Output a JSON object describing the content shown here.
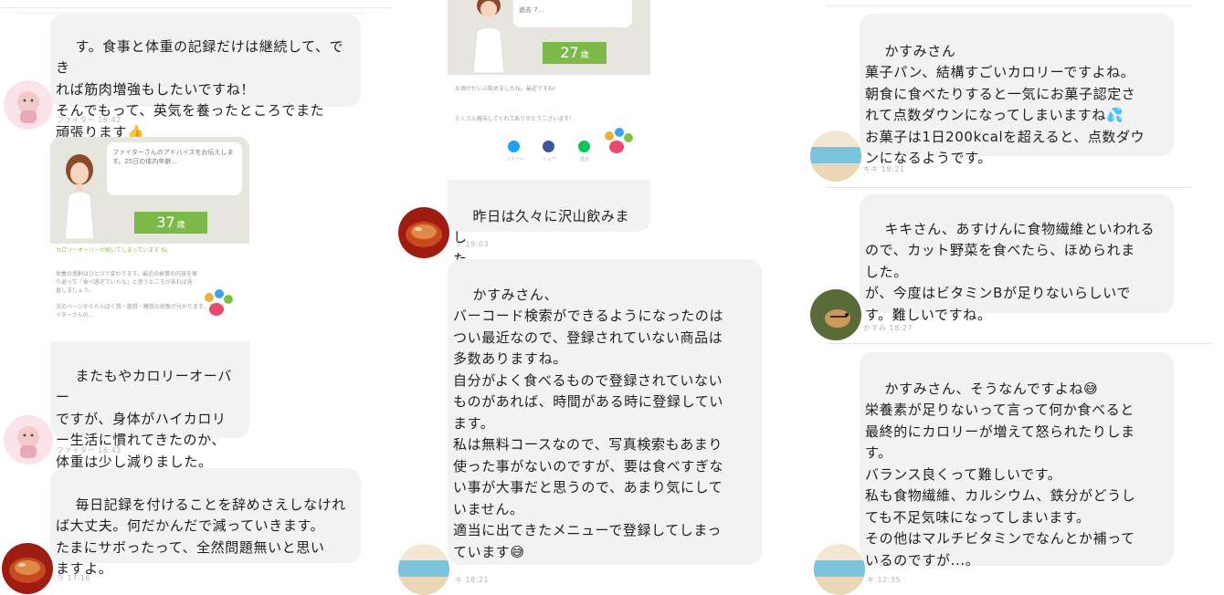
{
  "col1": {
    "msg1": {
      "text": "す。食事と体重の記録だけは継続して、でき\nれば筋肉増強もしたいですね！\nそんでもって、英気を養ったところでまた\n頑張ります👍",
      "meta": "ファイター 16:42"
    },
    "card": {
      "speech": "ファイターさんのアドバイスをお伝えします。25日の体内年齢...",
      "age": "37",
      "age_unit": "歳",
      "headline": "カロリーオーバーが続いてしまっています ね。",
      "body1": "栄養の過剰はひとつで変わります。最近の食事の内容を振り返って「食べ過ぎていたな」と思うところがあれば見直しましょう。",
      "body2": "次のページからたんぱく質・脂質・糖質の状態が分かります。ファイターさんの..."
    },
    "msg2": {
      "text": "またもやカロリーオーバー\nですが、身体がハイカロリ\nー生活に慣れてきたのか、\n体重は少し減りました。",
      "meta": "ファイター 16:43"
    },
    "msg3": {
      "text": "毎日記録を付けることを辞めさえしなけれ\nば大丈夫。何だかんだで減っていきます。\nたまにサボったって、全然問題無いと思い\nますよ。",
      "meta": "ラ 17:16"
    }
  },
  "col2": {
    "card": {
      "speech": "過去 7...",
      "age": "27",
      "age_unit": "歳",
      "line1": "お酒がだいぶ飲めましたね。最近ですね！",
      "line2": "たくさん報告してくれてありがとうございます！",
      "share": [
        "ツイート",
        "シェア",
        "送る"
      ]
    },
    "msg1": {
      "text": "昨日は久々に沢山飲みまし\nた",
      "meta": "ラ 19:03"
    },
    "msg2": {
      "text": "かすみさん、\nバーコード検索ができるようになったのは\nつい最近なので、登録されていない商品は\n多数ありますね。\n自分がよく食べるもので登録されていない\nものがあれば、時間がある時に登録してい\nます。\n私は無料コースなので、写真検索もあまり\n使った事がないのですが、要は食べすぎな\nい事が大事だと思うので、あまり気にして\nいません。\n適当に出てきたメニューで登録してしまっ\nています😅",
      "meta": "キ 18:21"
    }
  },
  "col3": {
    "msg1": {
      "text": "かすみさん\n菓子パン、結構すごいカロリーですよね。\n朝食に食べたりすると一気にお菓子認定さ\nれて点数ダウンになってしまいますね💦\nお菓子は1日200kcalを超えると、点数ダウ\nンになるようです。",
      "meta": "キキ 18:21"
    },
    "msg2": {
      "text": "キキさん、あすけんに食物繊維といわれる\nので、カット野菜を食べたら、ほめられま\nした。\nが、今度はビタミンBが足りないらしいで\nす。難しいですね。",
      "meta": "かすみ 18:27"
    },
    "msg3": {
      "text": "かすみさん、そうなんですよね😅\n栄養素が足りないって言って何か食べると\n最終的にカロリーが増えて怒られたりしま\nす。\nバランス良くって難しいです。\n私も食物繊維、カルシウム、鉄分がどうし\nても不足気味になってしまいます。\nその他はマルチビタミンでなんとか補って\nいるのですが...。",
      "meta": "キ 12:35"
    }
  },
  "colors": {
    "bubble": "#f2f2f2",
    "age_green": "#7db84a",
    "twitter": "#1da1f2",
    "facebook": "#3b5998",
    "line": "#06c755"
  },
  "icons": [
    "thumbs-up-icon",
    "sweat-drops-icon",
    "grin-sweat-icon",
    "paw-logo-icon",
    "twitter-icon",
    "facebook-icon",
    "line-icon"
  ]
}
